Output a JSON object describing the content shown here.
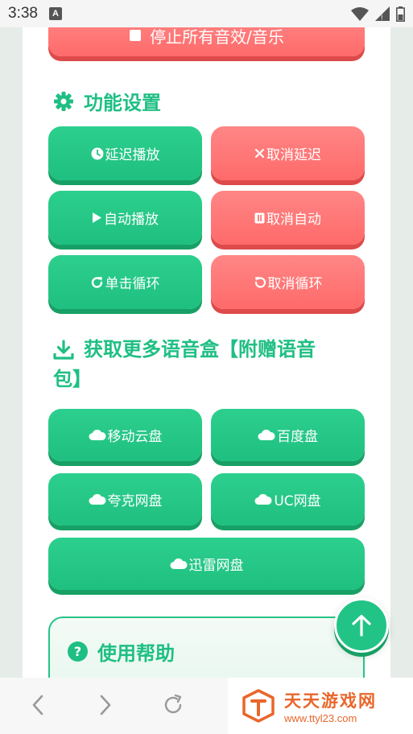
{
  "status_bar": {
    "time": "3:38",
    "notification_letter": "A"
  },
  "top_button": {
    "label": "停止所有音效/音乐"
  },
  "function_settings": {
    "title": "功能设置",
    "buttons": [
      {
        "label": "延迟播放",
        "color": "green"
      },
      {
        "label": "取消延迟",
        "color": "red"
      },
      {
        "label": "自动播放",
        "color": "green"
      },
      {
        "label": "取消自动",
        "color": "red"
      },
      {
        "label": "单击循环",
        "color": "green"
      },
      {
        "label": "取消循环",
        "color": "red"
      }
    ]
  },
  "more_boxes": {
    "title": "获取更多语音盒【附赠语音包】",
    "buttons": [
      {
        "label": "移动云盘"
      },
      {
        "label": "百度盘"
      },
      {
        "label": "夸克网盘"
      },
      {
        "label": "UC网盘"
      },
      {
        "label": "迅雷网盘"
      }
    ]
  },
  "help": {
    "title": "使用帮助"
  },
  "watermark": {
    "name": "天天游戏网",
    "url": "www.ttyl23.com"
  },
  "colors": {
    "green": "#22c485",
    "red": "#ff7676",
    "title_green": "#1fbf84",
    "watermark_orange": "#e9662a"
  }
}
